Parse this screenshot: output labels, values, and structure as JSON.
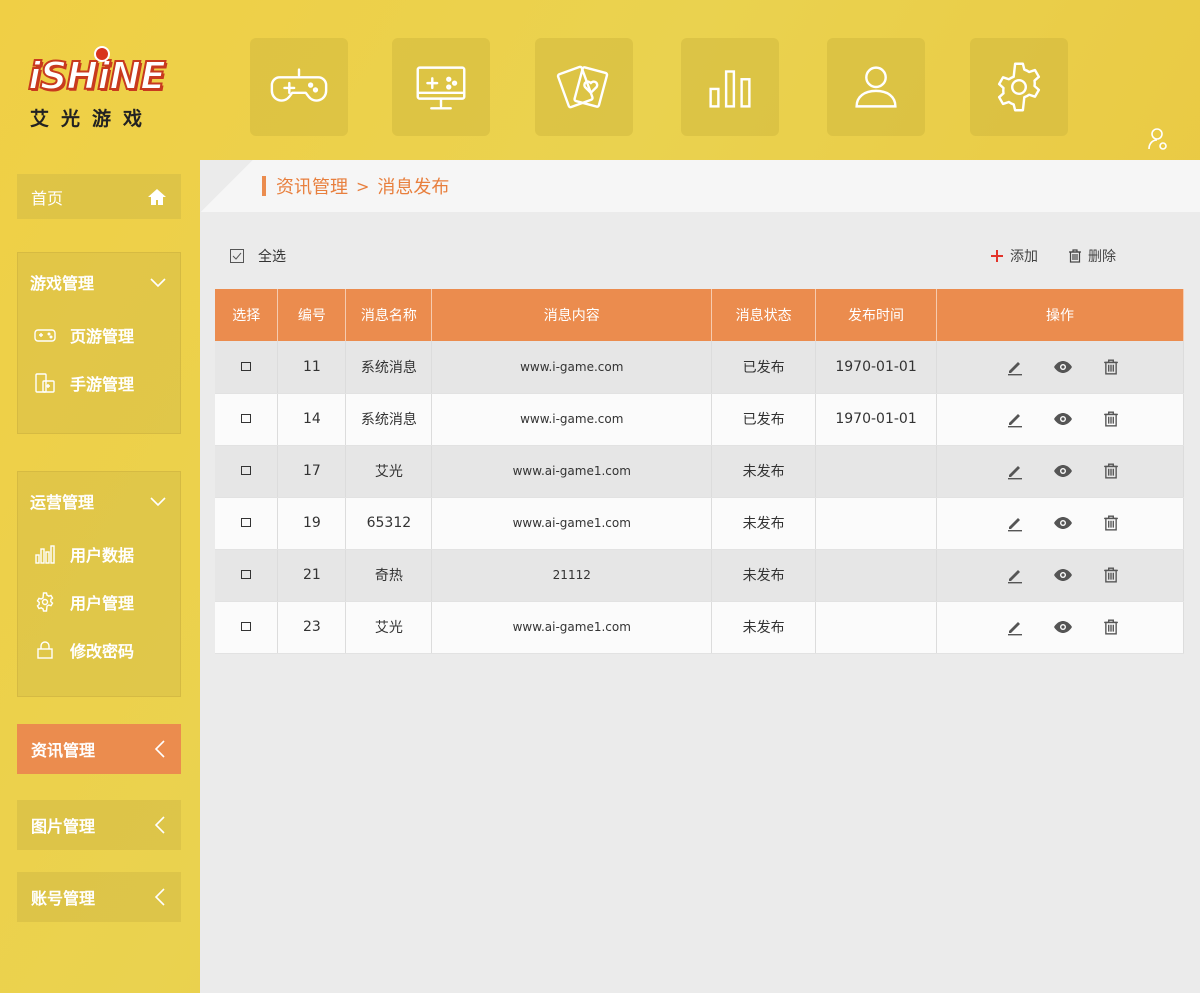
{
  "logo": {
    "text": "iSHiNE",
    "subtitle": "艾光游戏"
  },
  "topnav": {
    "items": [
      {
        "name": "gamepad-icon"
      },
      {
        "name": "monitor-game-icon"
      },
      {
        "name": "cards-icon"
      },
      {
        "name": "bar-chart-icon"
      },
      {
        "name": "user-icon"
      },
      {
        "name": "gear-icon"
      }
    ]
  },
  "sidebar": {
    "home": "首页",
    "game_group": {
      "title": "游戏管理",
      "items": [
        "页游管理",
        "手游管理"
      ]
    },
    "ops_group": {
      "title": "运营管理",
      "items": [
        "用户数据",
        "用户管理",
        "修改密码"
      ]
    },
    "news": "资讯管理",
    "images": "图片管理",
    "accounts": "账号管理"
  },
  "breadcrumb": {
    "section": "资讯管理",
    "sep": ">",
    "page": "消息发布"
  },
  "toolbar": {
    "select_all": "全选",
    "add": "添加",
    "delete": "删除"
  },
  "table": {
    "headers": [
      "选择",
      "编号",
      "消息名称",
      "消息内容",
      "消息状态",
      "发布时间",
      "操作"
    ],
    "rows": [
      {
        "id": "11",
        "name": "系统消息",
        "content": "www.i-game.com",
        "status": "已发布",
        "time": "1970-01-01"
      },
      {
        "id": "14",
        "name": "系统消息",
        "content": "www.i-game.com",
        "status": "已发布",
        "time": "1970-01-01"
      },
      {
        "id": "17",
        "name": "艾光",
        "content": "www.ai-game1.com",
        "status": "未发布",
        "time": ""
      },
      {
        "id": "19",
        "name": "65312",
        "content": "www.ai-game1.com",
        "status": "未发布",
        "time": ""
      },
      {
        "id": "21",
        "name": "奇热",
        "content": "21112",
        "status": "未发布",
        "time": ""
      },
      {
        "id": "23",
        "name": "艾光",
        "content": "www.ai-game1.com",
        "status": "未发布",
        "time": ""
      }
    ]
  },
  "colors": {
    "accent": "#eb8c4e",
    "background": "#ebd04b",
    "content_bg": "#ebebeb"
  }
}
